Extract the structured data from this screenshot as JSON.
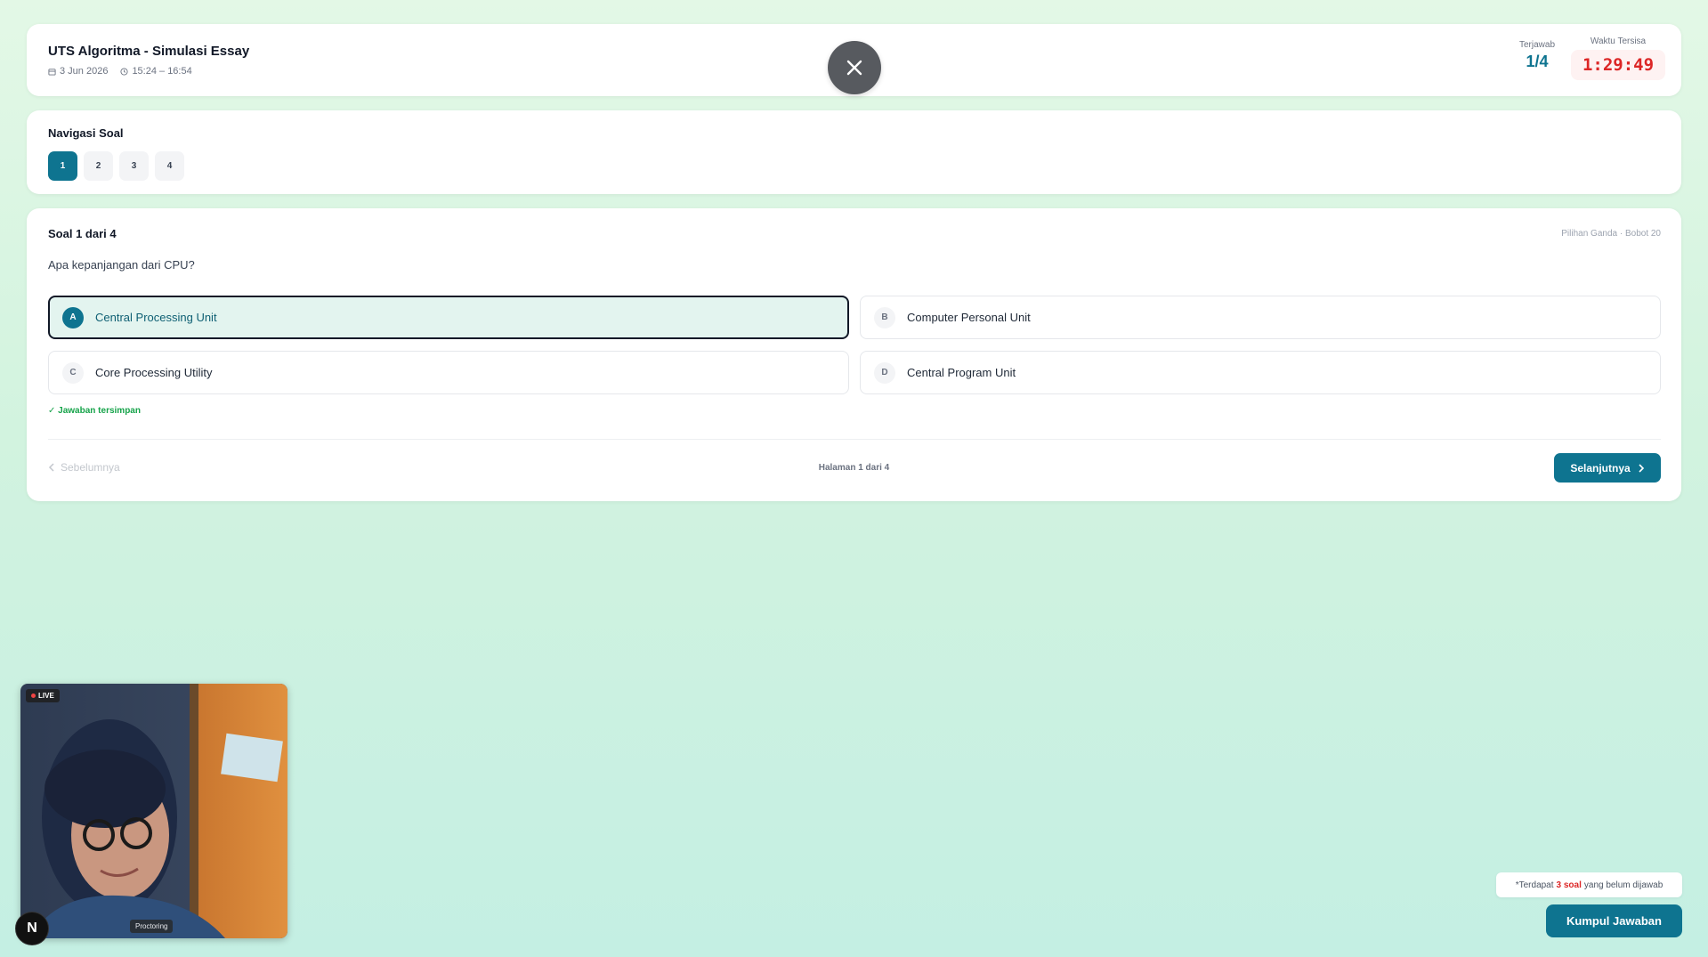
{
  "header": {
    "title": "UTS Algoritma - Simulasi Essay",
    "date": "3 Jun 2026",
    "time_range": "15:24 – 16:54",
    "answered_label": "Terjawab",
    "answered_value": "1/4",
    "timer_label": "Waktu Tersisa",
    "timer_value": "1:29:49"
  },
  "navigation": {
    "title": "Navigasi Soal",
    "items": [
      "1",
      "2",
      "3",
      "4"
    ],
    "active": "1"
  },
  "question": {
    "number_label": "Soal 1 dari 4",
    "meta": "Pilihan Ganda · Bobot 20",
    "text": "Apa kepanjangan dari CPU?",
    "options": [
      {
        "letter": "A",
        "text": "Central Processing Unit"
      },
      {
        "letter": "B",
        "text": "Computer Personal Unit"
      },
      {
        "letter": "C",
        "text": "Core Processing Utility"
      },
      {
        "letter": "D",
        "text": "Central Program Unit"
      }
    ],
    "selected": "A",
    "saved_note": "✓ Jawaban tersimpan"
  },
  "pager": {
    "prev_label": "Sebelumnya",
    "page_indicator": "Halaman 1 dari 4",
    "next_label": "Selanjutnya"
  },
  "proctoring": {
    "live_label": "LIVE",
    "label": "Proctoring"
  },
  "logo_letter": "N",
  "submit": {
    "note_prefix": "*Terdapat",
    "note_count": "3 soal",
    "note_suffix": "yang belum dijawab",
    "button_label": "Kumpul Jawaban"
  },
  "colors": {
    "accent": "#0e7490",
    "timer": "#dc2626",
    "saved": "#16a34a"
  }
}
